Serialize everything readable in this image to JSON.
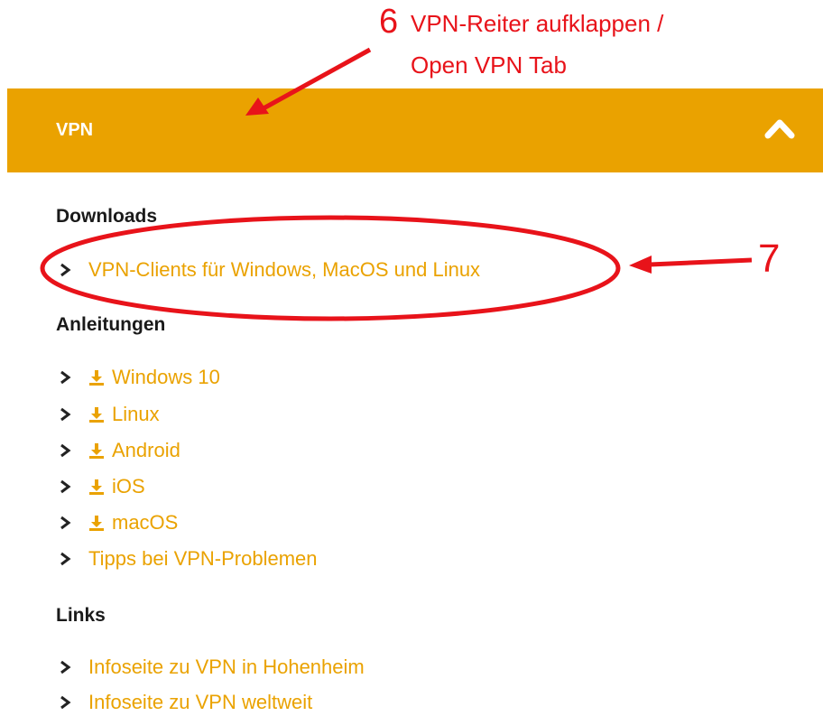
{
  "annotations": {
    "step6_number": "6",
    "step6_line1": "VPN-Reiter aufklappen /",
    "step6_line2": "Open VPN Tab",
    "step7_number": "7",
    "color": "#e8131a"
  },
  "panel": {
    "title": "VPN",
    "header_color": "#eaa200",
    "toggle_icon": "chevron-up-icon"
  },
  "downloads": {
    "heading": "Downloads",
    "items": [
      {
        "label": "VPN-Clients für Windows, MacOS und Linux"
      }
    ]
  },
  "guides": {
    "heading": "Anleitungen",
    "items": [
      {
        "label": "Windows 10",
        "icon": "download-icon"
      },
      {
        "label": "Linux",
        "icon": "download-icon"
      },
      {
        "label": "Android",
        "icon": "download-icon"
      },
      {
        "label": "iOS",
        "icon": "download-icon"
      },
      {
        "label": "macOS",
        "icon": "download-icon"
      },
      {
        "label": "Tipps bei VPN-Problemen"
      }
    ]
  },
  "links": {
    "heading": "Links",
    "items": [
      {
        "label": "Infoseite zu VPN in Hohenheim"
      },
      {
        "label": "Infoseite zu VPN weltweit"
      }
    ]
  },
  "link_color": "#eaa200"
}
